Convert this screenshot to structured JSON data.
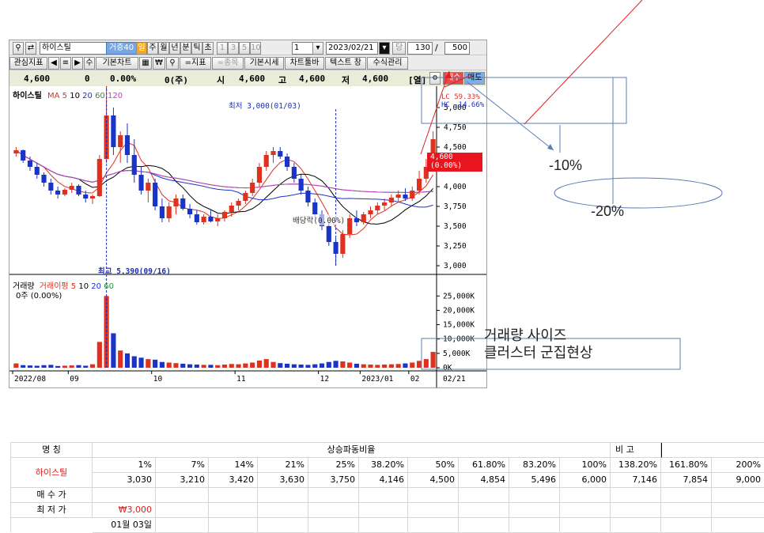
{
  "toolbar": {
    "stock_name": "하이스틸",
    "badge": "거증40",
    "period_tabs": [
      "일",
      "주",
      "월",
      "년",
      "분",
      "틱",
      "초"
    ],
    "minute_opts": [
      "1",
      "3",
      "5",
      "10"
    ],
    "count_value": "1",
    "date_value": "2023/02/21",
    "rank_label": "당",
    "display_count": "130",
    "slash": "/",
    "max_count": "500"
  },
  "toolbar2": {
    "buttons": [
      "관심지표",
      "◀",
      "≡",
      "▶",
      "수",
      "기본차트",
      "▦",
      "₩",
      "⚲",
      "=지표",
      "=종목",
      "기본시세",
      "차트툴바",
      "텍스트 창",
      "수식관리"
    ]
  },
  "quote_bar": {
    "price": "4,600",
    "change": "0",
    "change_pct": "0.00%",
    "volume": "0(주)",
    "open_label": "시",
    "open": "4,600",
    "high_label": "고",
    "high": "4,600",
    "low_label": "저",
    "low": "4,600",
    "col_label": "[열]",
    "buy_label": "매수",
    "sell_label": "매도"
  },
  "price_chart": {
    "title": "하이스틸",
    "ma_label": "MA",
    "ma_periods": [
      "5",
      "10",
      "20",
      "60",
      "120"
    ],
    "low_note": "최저 3,000(01/03)",
    "high_note": "최고 5,390(09/16)",
    "price_tag": "4,600",
    "price_tag_pct": "(0.00%)",
    "ex_dividend_note": "배당락(0.00%)",
    "lc_note": "LC 59.33%",
    "hc_note": "HC -14.66%",
    "y_ticks": [
      "5,000",
      "4,750",
      "4,500",
      "4,250",
      "4,000",
      "3,750",
      "3,500",
      "3,250",
      "3,000"
    ]
  },
  "volume_chart": {
    "title": "거래량",
    "ma_label": "거래이평",
    "ma_periods": [
      "5",
      "10",
      "20",
      "60"
    ],
    "zero_note": "0주 (0.00%)",
    "y_ticks": [
      "25,000K",
      "20,000K",
      "15,000K",
      "10,000K",
      "5,000K",
      "0K"
    ]
  },
  "x_axis": {
    "ticks": [
      "2022/08",
      "09",
      "10",
      "11",
      "12",
      "2023/01",
      "02"
    ],
    "last_date": "02/21"
  },
  "annotations": {
    "pct_minus10": "-10%",
    "pct_minus20": "-20%",
    "volume_note_line1": "거래량 사이즈",
    "volume_note_line2": "클러스터 군집현상"
  },
  "table": {
    "col_name_header": "명     칭",
    "ratio_header": "상승파동비율",
    "note_header": "비     고",
    "ratios": [
      "1%",
      "7%",
      "14%",
      "21%",
      "25%",
      "38.20%",
      "50%",
      "61.80%",
      "83.20%",
      "100%",
      "138.20%",
      "161.80%",
      "200%"
    ],
    "stock_name": "하이스틸",
    "prices": [
      "3,030",
      "3,210",
      "3,420",
      "3,630",
      "3,750",
      "4,146",
      "4,500",
      "4,854",
      "5,496",
      "6,000",
      "7,146",
      "7,854",
      "9,000"
    ],
    "row_buy_label": "매 수 가",
    "row_low_label": "최 저 가",
    "low_price": "₩3,000",
    "low_date": "01월 03일"
  },
  "chart_data": {
    "type": "candlestick",
    "title": "하이스틸",
    "xlabel": "",
    "ylabel": "",
    "ylim": [
      2950,
      5150
    ],
    "x_ticks": [
      "2022/08",
      "09",
      "10",
      "11",
      "12",
      "2023/01",
      "02"
    ],
    "candles": [
      [
        4420,
        4500,
        4380,
        4460
      ],
      [
        4460,
        4470,
        4300,
        4330
      ],
      [
        4330,
        4380,
        4200,
        4250
      ],
      [
        4250,
        4300,
        4100,
        4150
      ],
      [
        4150,
        4180,
        4000,
        4050
      ],
      [
        4050,
        4100,
        3900,
        3950
      ],
      [
        3950,
        4000,
        3850,
        3900
      ],
      [
        3900,
        3980,
        3880,
        3960
      ],
      [
        3960,
        4050,
        3920,
        4010
      ],
      [
        4010,
        4030,
        3880,
        3900
      ],
      [
        3900,
        3950,
        3800,
        3850
      ],
      [
        3850,
        3900,
        3780,
        3880
      ],
      [
        3880,
        4400,
        3870,
        4350
      ],
      [
        4350,
        5390,
        4300,
        4900
      ],
      [
        4900,
        5000,
        4400,
        4500
      ],
      [
        4500,
        4700,
        4300,
        4650
      ],
      [
        4650,
        4800,
        4300,
        4400
      ],
      [
        4400,
        4600,
        4050,
        4150
      ],
      [
        4150,
        4250,
        3900,
        3950
      ],
      [
        3950,
        4100,
        3800,
        4050
      ],
      [
        4050,
        4100,
        3700,
        3750
      ],
      [
        3750,
        3850,
        3550,
        3600
      ],
      [
        3600,
        3800,
        3550,
        3750
      ],
      [
        3750,
        3900,
        3650,
        3850
      ],
      [
        3850,
        3900,
        3700,
        3720
      ],
      [
        3720,
        3780,
        3600,
        3650
      ],
      [
        3650,
        3700,
        3520,
        3550
      ],
      [
        3550,
        3650,
        3520,
        3620
      ],
      [
        3620,
        3700,
        3550,
        3560
      ],
      [
        3560,
        3650,
        3500,
        3600
      ],
      [
        3600,
        3700,
        3560,
        3680
      ],
      [
        3680,
        3800,
        3620,
        3760
      ],
      [
        3760,
        3850,
        3700,
        3820
      ],
      [
        3820,
        3950,
        3780,
        3920
      ],
      [
        3920,
        4100,
        3880,
        4050
      ],
      [
        4050,
        4300,
        4000,
        4250
      ],
      [
        4250,
        4450,
        4200,
        4400
      ],
      [
        4400,
        4500,
        4300,
        4450
      ],
      [
        4450,
        4500,
        4350,
        4380
      ],
      [
        4380,
        4420,
        4200,
        4250
      ],
      [
        4250,
        4300,
        4050,
        4100
      ],
      [
        4100,
        4150,
        3900,
        3950
      ],
      [
        3950,
        4000,
        3750,
        3800
      ],
      [
        3800,
        3850,
        3600,
        3650
      ],
      [
        3650,
        3700,
        3450,
        3500
      ],
      [
        3500,
        3550,
        3250,
        3300
      ],
      [
        3300,
        3350,
        3000,
        3150
      ],
      [
        3150,
        3450,
        3100,
        3400
      ],
      [
        3400,
        3650,
        3350,
        3600
      ],
      [
        3600,
        3700,
        3500,
        3550
      ],
      [
        3550,
        3680,
        3520,
        3650
      ],
      [
        3650,
        3750,
        3600,
        3700
      ],
      [
        3700,
        3800,
        3650,
        3760
      ],
      [
        3760,
        3850,
        3700,
        3800
      ],
      [
        3800,
        3900,
        3750,
        3860
      ],
      [
        3860,
        3950,
        3800,
        3900
      ],
      [
        3900,
        3980,
        3820,
        3850
      ],
      [
        3850,
        4000,
        3820,
        3950
      ],
      [
        3950,
        4200,
        3900,
        4100
      ],
      [
        4100,
        4350,
        4050,
        4250
      ],
      [
        4250,
        4700,
        4200,
        4600
      ]
    ],
    "volume": [
      1500,
      900,
      800,
      700,
      900,
      1000,
      600,
      700,
      800,
      900,
      700,
      1200,
      9000,
      25000,
      12000,
      6000,
      5000,
      4000,
      3500,
      3000,
      2800,
      2000,
      1800,
      1600,
      1400,
      1200,
      1100,
      1000,
      1000,
      900,
      1100,
      1300,
      1200,
      1500,
      1800,
      2500,
      3000,
      2000,
      1600,
      1400,
      1200,
      1100,
      1000,
      1200,
      1500,
      2000,
      2400,
      2200,
      1800,
      1400,
      1200,
      1100,
      1000,
      1100,
      1200,
      1300,
      1500,
      1800,
      2400,
      3000,
      5500
    ]
  }
}
